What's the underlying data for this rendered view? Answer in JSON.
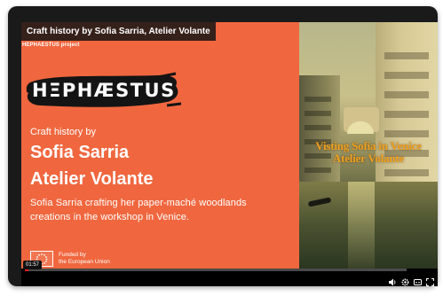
{
  "video": {
    "title": "Craft history by Sofia Sarria, Atelier Volante",
    "project_label": "HEPHAESTUS project",
    "logo_text": "HΞPHÆSTUS",
    "kicker": "Craft history by",
    "headline_line1": "Sofia Sarria",
    "headline_line2": "Atelier Volante",
    "description": "Sofia Sarria crafting her paper-maché woodlands creations in the workshop in Venice.",
    "eu_funding_line1": "Funded by",
    "eu_funding_line2": "the European Union",
    "right_caption_line1": "Visting Sofia in Venice",
    "right_caption_line2": "Atelier Volante"
  },
  "player": {
    "current_time": "01:57",
    "progress_fraction": 0.01,
    "icons": [
      "volume-icon",
      "settings-icon",
      "subtitles-icon",
      "fullscreen-icon"
    ]
  },
  "colors": {
    "slide_background": "#f0673f",
    "caption_color": "#f0a01e",
    "progress_color": "#ff1a1a"
  }
}
